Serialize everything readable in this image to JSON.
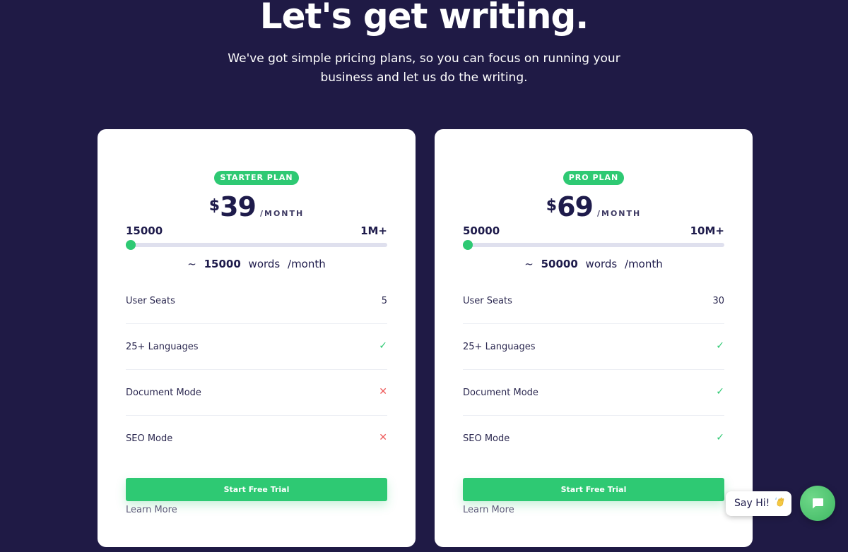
{
  "hero": {
    "title": "Let's get writing.",
    "subtitle": "We've got simple pricing plans, so you can focus on running your business and let us do the writing."
  },
  "colors": {
    "background": "#1f1a45",
    "accent": "#2ec973",
    "cross": "#ee5a5a",
    "text_dark": "#1e1b4b"
  },
  "plans": [
    {
      "badge": "STARTER PLAN",
      "currency": "$",
      "price": "39",
      "period": "/MONTH",
      "range_min": "15000",
      "range_max": "1M+",
      "slider_fraction": 0,
      "words_prefix": "~",
      "words_count": "15000",
      "words_unit": "words",
      "words_period": "/month",
      "features": [
        {
          "label": "User Seats",
          "value": "5",
          "type": "text"
        },
        {
          "label": "25+ Languages",
          "value": "",
          "type": "check"
        },
        {
          "label": "Document Mode",
          "value": "",
          "type": "cross"
        },
        {
          "label": "SEO Mode",
          "value": "",
          "type": "cross"
        }
      ],
      "cta_label": "Start Free Trial",
      "learn_more": "Learn More"
    },
    {
      "badge": "PRO PLAN",
      "currency": "$",
      "price": "69",
      "period": "/MONTH",
      "range_min": "50000",
      "range_max": "10M+",
      "slider_fraction": 0,
      "words_prefix": "~",
      "words_count": "50000",
      "words_unit": "words",
      "words_period": "/month",
      "features": [
        {
          "label": "User Seats",
          "value": "30",
          "type": "text"
        },
        {
          "label": "25+ Languages",
          "value": "",
          "type": "check"
        },
        {
          "label": "Document Mode",
          "value": "",
          "type": "check"
        },
        {
          "label": "SEO Mode",
          "value": "",
          "type": "check"
        }
      ],
      "cta_label": "Start Free Trial",
      "learn_more": "Learn More"
    }
  ],
  "chat": {
    "say_hi": "Say Hi!",
    "wave_icon": "waving-hand-icon",
    "button_icon": "chat-bubble-icon"
  }
}
